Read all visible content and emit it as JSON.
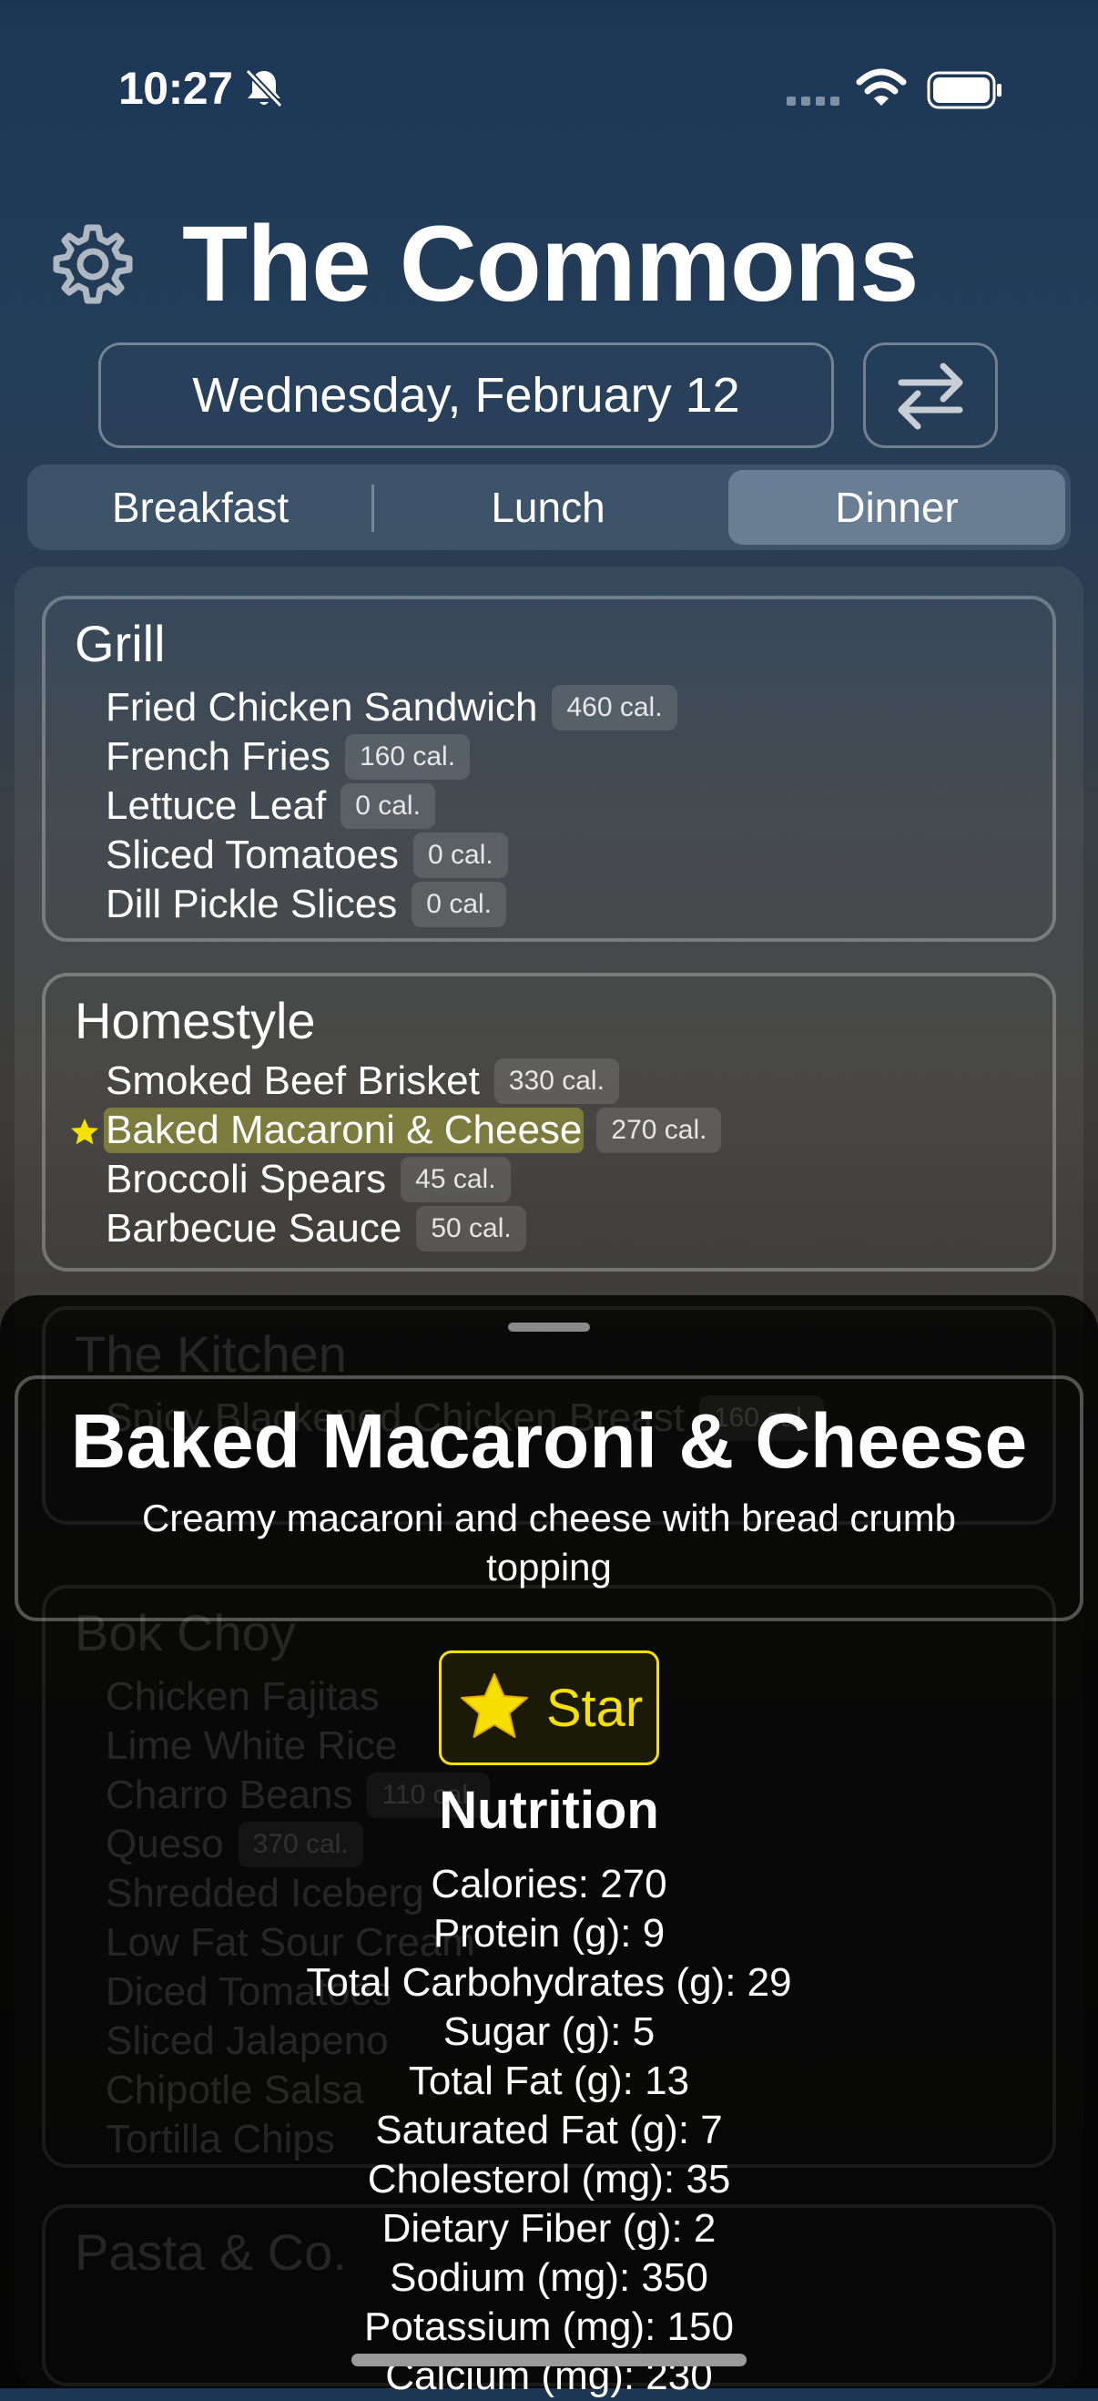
{
  "status_bar": {
    "time": "10:27",
    "icons": [
      "bell-slash-icon",
      "signal-dots-icon",
      "wifi-icon",
      "battery-icon"
    ]
  },
  "header": {
    "title": "The Commons",
    "settings_icon": "gear-icon"
  },
  "date_picker": {
    "label": "Wednesday, February 12",
    "swap_icon": "arrows-swap-icon"
  },
  "meal_tabs": {
    "items": [
      "Breakfast",
      "Lunch",
      "Dinner"
    ],
    "selected": "Dinner"
  },
  "stations": [
    {
      "name": "Grill",
      "items": [
        {
          "name": "Fried Chicken Sandwich",
          "cal": "460 cal."
        },
        {
          "name": "French Fries",
          "cal": "160 cal."
        },
        {
          "name": "Lettuce Leaf",
          "cal": "0 cal."
        },
        {
          "name": "Sliced Tomatoes",
          "cal": "0 cal."
        },
        {
          "name": "Dill Pickle Slices",
          "cal": "0 cal."
        }
      ]
    },
    {
      "name": "Homestyle",
      "items": [
        {
          "name": "Smoked Beef Brisket",
          "cal": "330 cal."
        },
        {
          "name": "Baked Macaroni & Cheese",
          "cal": "270 cal.",
          "starred": true
        },
        {
          "name": "Broccoli Spears",
          "cal": "45 cal."
        },
        {
          "name": "Barbecue Sauce",
          "cal": "50 cal."
        }
      ]
    },
    {
      "name": "The Kitchen",
      "items": [
        {
          "name": "Spicy Blackened Chicken Breast",
          "cal": "160 cal."
        }
      ]
    },
    {
      "name": "Bok Choy",
      "items": [
        {
          "name": "Chicken Fajitas"
        },
        {
          "name": "Lime White Rice"
        },
        {
          "name": "Charro Beans",
          "cal": "110 cal."
        },
        {
          "name": "Queso",
          "cal": "370 cal."
        },
        {
          "name": "Shredded Iceberg"
        },
        {
          "name": "Low Fat Sour Cream"
        },
        {
          "name": "Diced Tomatoes"
        },
        {
          "name": "Sliced Jalapeno"
        },
        {
          "name": "Chipotle Salsa"
        },
        {
          "name": "Tortilla Chips"
        }
      ]
    },
    {
      "name": "Pasta & Co.",
      "items": []
    }
  ],
  "detail": {
    "name": "Baked Macaroni & Cheese",
    "description": "Creamy macaroni and cheese with bread crumb topping",
    "star_label": "Star",
    "star_icon": "star-icon",
    "nutrition_title": "Nutrition",
    "nutrition": [
      "Calories: 270",
      "Protein (g): 9",
      "Total Carbohydrates (g): 29",
      "Sugar (g): 5",
      "Total Fat (g): 13",
      "Saturated Fat (g): 7",
      "Cholesterol (mg): 35",
      "Dietary Fiber (g): 2",
      "Sodium (mg): 350",
      "Potassium (mg): 150",
      "Calcium (mg): 230"
    ]
  },
  "colors": {
    "star": "#f5e000",
    "highlight": "#bebe3c"
  }
}
